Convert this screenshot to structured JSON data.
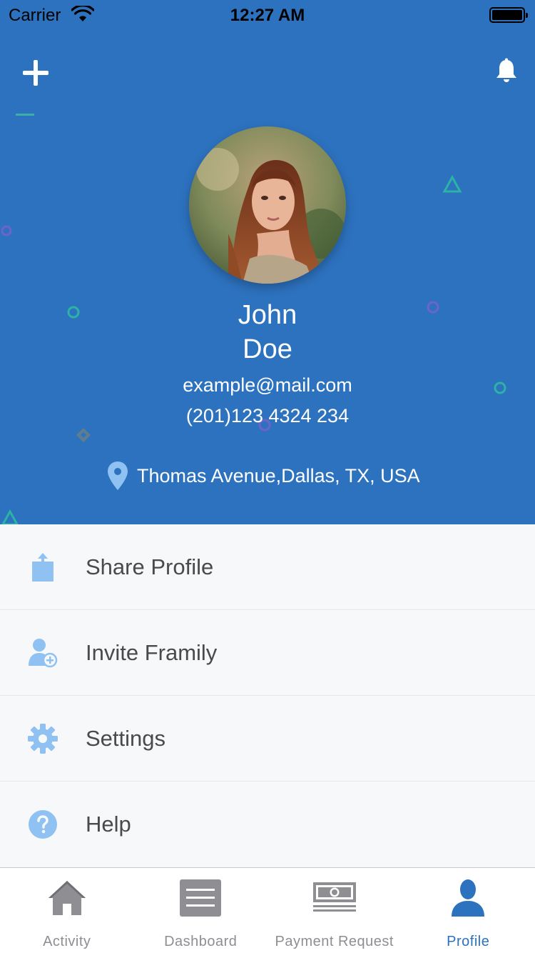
{
  "status_bar": {
    "carrier": "Carrier",
    "time": "12:27 AM"
  },
  "header": {
    "add_icon": "plus-icon",
    "notification_icon": "bell-icon",
    "avatar": "profile-photo"
  },
  "profile": {
    "first_name": "John",
    "last_name": "Doe",
    "email": "example@mail.com",
    "phone": "(201)123 4324 234",
    "location": "Thomas Avenue,Dallas, TX, USA"
  },
  "menu": [
    {
      "label": "Share Profile",
      "icon": "share-icon"
    },
    {
      "label": "Invite Framily",
      "icon": "add-user-icon"
    },
    {
      "label": "Settings",
      "icon": "gear-icon"
    },
    {
      "label": "Help",
      "icon": "help-icon"
    }
  ],
  "tabs": [
    {
      "label": "Activity",
      "icon": "home-icon"
    },
    {
      "label": "Dashboard",
      "icon": "dashboard-icon"
    },
    {
      "label": "Payment Request",
      "icon": "money-icon"
    },
    {
      "label": "Profile",
      "icon": "profile-icon",
      "active": true
    }
  ],
  "colors": {
    "header_bg": "#2d72bf",
    "menu_icon": "#8fc1f2",
    "tab_active": "#2d72bf",
    "tab_inactive": "#8e8e93"
  }
}
